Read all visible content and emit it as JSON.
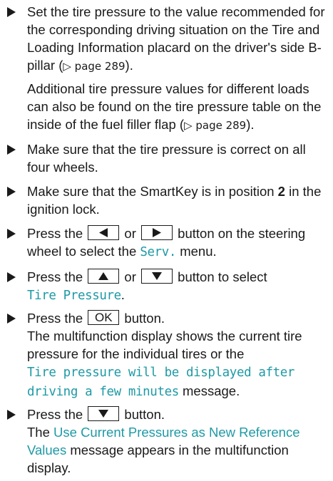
{
  "steps": [
    {
      "pre": "Set the tire pressure to the value recommended for the corresponding driving situation on the Tire and Loading Information placard on the driver's side B-pillar (",
      "ref": "▷ page 289",
      "post": ").",
      "note_pre": "Additional tire pressure values for different loads can also be found on the tire pressure table on the inside of the fuel filler flap (",
      "note_ref": "▷ page 289",
      "note_post": ")."
    },
    {
      "text": "Make sure that the tire pressure is correct on all four wheels."
    },
    {
      "pre": "Make sure that the SmartKey is in position ",
      "bold": "2",
      "post": " in the ignition lock."
    },
    {
      "pre": "Press the ",
      "btn_left": "left-arrow-icon",
      "mid": " or ",
      "btn_right": "right-arrow-icon",
      "post": " button on the steering wheel to select the ",
      "display": "Serv.",
      "end": " menu."
    },
    {
      "pre": "Press the ",
      "btn_up": "up-arrow-icon",
      "mid": " or ",
      "btn_down": "down-arrow-icon",
      "post": " button to select",
      "display": "Tire Pressure",
      "end": "."
    },
    {
      "pre": "Press the ",
      "btn": "OK",
      "post": " button.",
      "line2": "The multifunction display shows the current tire pressure for the individual tires or the",
      "display": "Tire pressure will be displayed after driving a few minutes",
      "end": " message."
    },
    {
      "pre": "Press the ",
      "btn_down": "down-arrow-icon",
      "post": " button.",
      "line2_pre": "The ",
      "display": "Use Current Pressures as New Reference Values",
      "line2_post": " message appears in the multifunction display."
    }
  ]
}
